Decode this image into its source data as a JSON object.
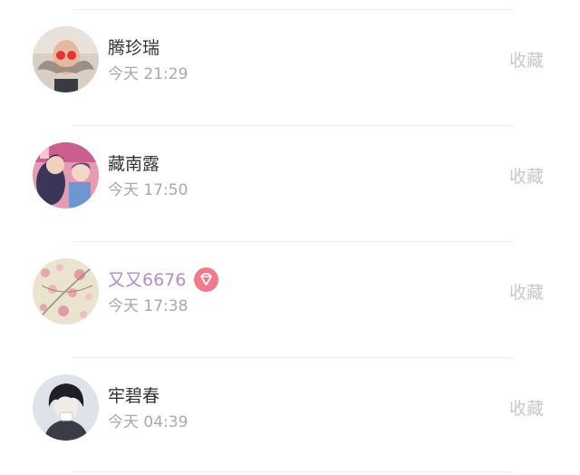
{
  "contacts": [
    {
      "name": "腾珍瑞",
      "time": "今天 21:29",
      "action": "收藏",
      "avatar_icon": "avatar-bald-mustache-icon",
      "vip": false
    },
    {
      "name": "藏南露",
      "time": "今天 17:50",
      "action": "收藏",
      "avatar_icon": "avatar-couple-illustration-icon",
      "vip": false
    },
    {
      "name": "又又6676",
      "time": "今天 17:38",
      "action": "收藏",
      "avatar_icon": "avatar-pink-flowers-icon",
      "vip": true,
      "badge_icon": "diamond-vip-badge-icon"
    },
    {
      "name": "牢碧春",
      "time": "今天 04:39",
      "action": "收藏",
      "avatar_icon": "avatar-dark-hair-boy-icon",
      "vip": false
    }
  ],
  "colors": {
    "name_text": "#333333",
    "vip_name_text": "#b58ad0",
    "time_text": "#a8a8a8",
    "action_text": "#c8c8c8",
    "divider": "#ececec",
    "vip_badge": "#f3798a"
  }
}
